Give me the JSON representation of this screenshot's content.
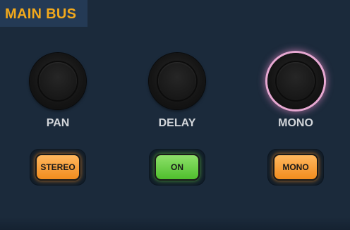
{
  "panel": {
    "title": "MAIN BUS",
    "accent_color": "#f2a91c",
    "background_color": "#1b2a3b"
  },
  "knobs": [
    {
      "label": "PAN",
      "icon": "rotary-knob"
    },
    {
      "label": "DELAY",
      "icon": "rotary-knob"
    },
    {
      "label": "MONO",
      "icon": "rotary-knob",
      "highlight_color": "#e7a8d2"
    }
  ],
  "buttons": [
    {
      "label": "STEREO",
      "color": "#f7a13a"
    },
    {
      "label": "ON",
      "color": "#63c83d"
    },
    {
      "label": "MONO",
      "color": "#f7a13a"
    }
  ]
}
